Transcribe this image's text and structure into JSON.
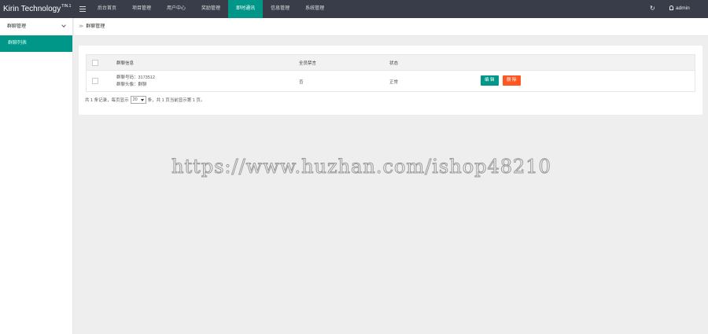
{
  "header": {
    "logo_text": "Kirin Technology",
    "logo_version": "TIN.1",
    "nav": [
      {
        "label": "后台首页",
        "active": false
      },
      {
        "label": "项目管理",
        "active": false
      },
      {
        "label": "用户中心",
        "active": false
      },
      {
        "label": "奖励管理",
        "active": false
      },
      {
        "label": "即时通讯",
        "active": true
      },
      {
        "label": "信息管理",
        "active": false
      },
      {
        "label": "系统管理",
        "active": false
      }
    ],
    "refresh_icon": "refresh-icon",
    "user_label": "admin",
    "accent_color": "#009688"
  },
  "sidebar": {
    "group_label": "群聊管理",
    "active_item": "群聊列表"
  },
  "breadcrumb": {
    "current": "群聊管理"
  },
  "table": {
    "headers": {
      "info": "群聊信息",
      "mute": "全员禁言",
      "status": "状态"
    },
    "rows": [
      {
        "id_line": "群聊号码：3173512",
        "head_line": "群聊头像：群聊",
        "mute": "否",
        "status": "正常",
        "edit_label": "编 辑",
        "delete_label": "删 除"
      }
    ]
  },
  "pager": {
    "prefix": "共 1 条记录，每页显示",
    "page_size": "20",
    "suffix": "条，共 1 页当前显示第 1 页。"
  },
  "watermark": "https://www.huzhan.com/ishop48210"
}
